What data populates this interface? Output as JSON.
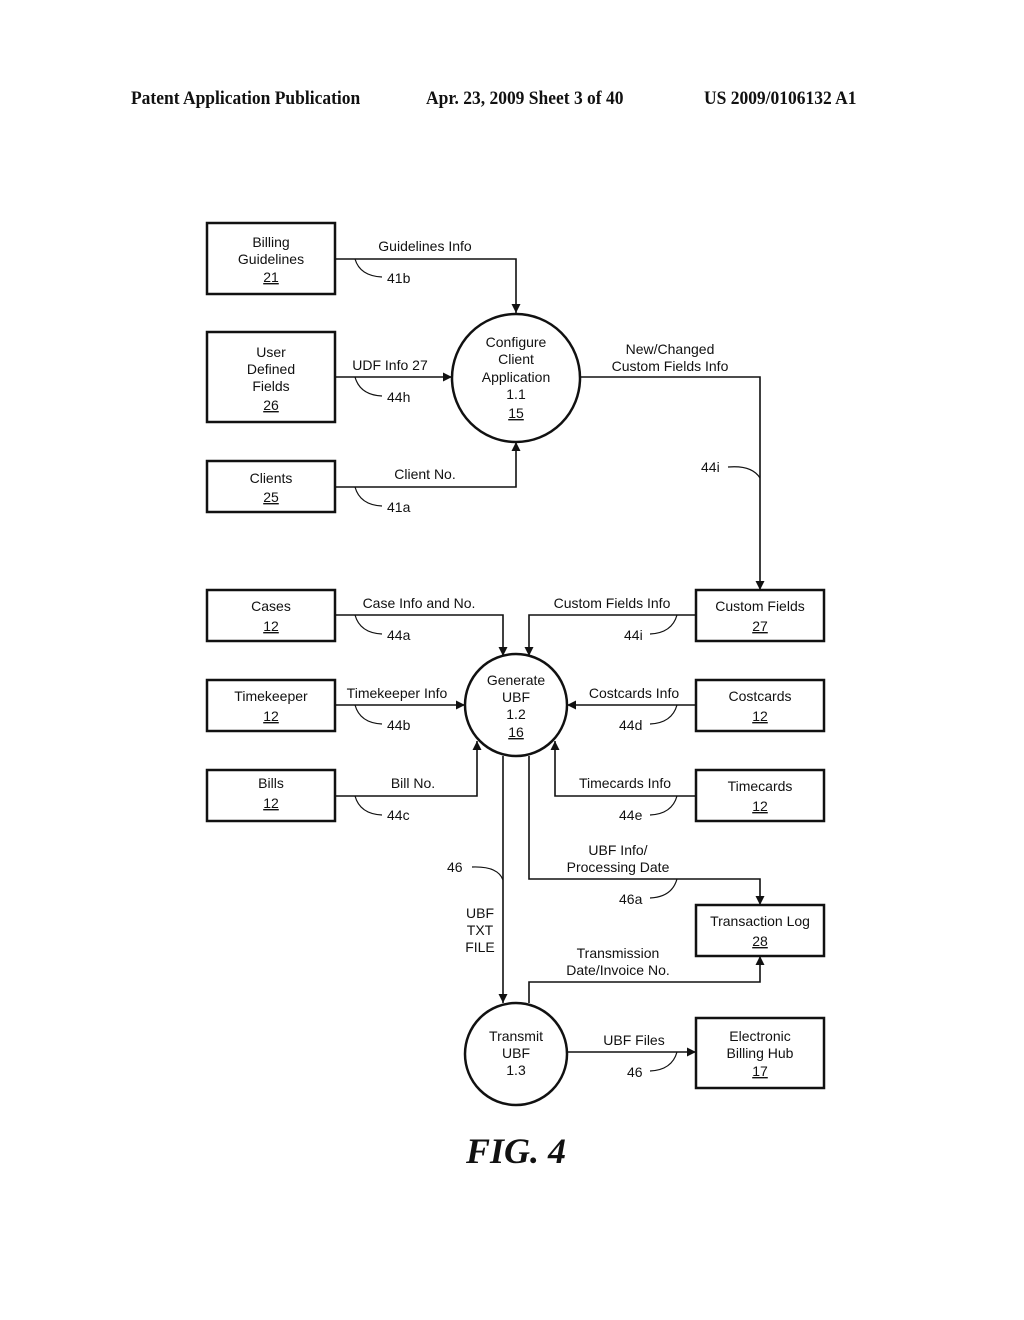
{
  "header": {
    "left": "Patent Application Publication",
    "center": "Apr. 23, 2009  Sheet 3 of 40",
    "right": "US 2009/0106132 A1"
  },
  "figure_label": "FIG. 4",
  "stores": {
    "billing_guidelines": {
      "lines": [
        "Billing",
        "Guidelines"
      ],
      "ref": "21"
    },
    "user_defined_fields": {
      "lines": [
        "User",
        "Defined",
        "Fields"
      ],
      "ref": "26"
    },
    "clients": {
      "lines": [
        "Clients"
      ],
      "ref": "25"
    },
    "custom_fields": {
      "lines": [
        "Custom Fields"
      ],
      "ref": "27"
    },
    "cases": {
      "lines": [
        "Cases"
      ],
      "ref": "12"
    },
    "timekeeper": {
      "lines": [
        "Timekeeper"
      ],
      "ref": "12"
    },
    "bills": {
      "lines": [
        "Bills"
      ],
      "ref": "12"
    },
    "costcards": {
      "lines": [
        "Costcards"
      ],
      "ref": "12"
    },
    "timecards": {
      "lines": [
        "Timecards"
      ],
      "ref": "12"
    },
    "transaction_log": {
      "lines": [
        "Transaction Log"
      ],
      "ref": "28"
    },
    "billing_hub": {
      "lines": [
        "Electronic",
        "Billing Hub"
      ],
      "ref": "17"
    }
  },
  "processes": {
    "configure": {
      "lines": [
        "Configure",
        "Client",
        "Application",
        "1.1"
      ],
      "ref": "15"
    },
    "generate": {
      "lines": [
        "Generate",
        "UBF",
        "1.2"
      ],
      "ref": "16"
    },
    "transmit": {
      "lines": [
        "Transmit",
        "UBF",
        "1.3"
      ]
    }
  },
  "flows": {
    "guidelines_info": {
      "label": "Guidelines Info",
      "ref": "41b"
    },
    "udf_info": {
      "label": "UDF Info 27",
      "ref": "44h"
    },
    "client_no": {
      "label": "Client No.",
      "ref": "41a"
    },
    "new_changed": {
      "label": [
        "New/Changed",
        "Custom Fields Info"
      ],
      "ref": "44i"
    },
    "case_info": {
      "label": "Case Info and No.",
      "ref": "44a"
    },
    "custom_fields_info": {
      "label": "Custom Fields Info",
      "ref": "44i"
    },
    "timekeeper_info": {
      "label": "Timekeeper Info",
      "ref": "44b"
    },
    "costcards_info": {
      "label": "Costcards Info",
      "ref": "44d"
    },
    "bill_no": {
      "label": "Bill No.",
      "ref": "44c"
    },
    "timecards_info": {
      "label": "Timecards Info",
      "ref": "44e"
    },
    "ubf_txt": {
      "label": [
        "UBF",
        "TXT",
        "FILE"
      ],
      "ref": "46"
    },
    "ubf_info": {
      "label": [
        "UBF Info/",
        "Processing Date"
      ],
      "ref": "46a"
    },
    "transmission": {
      "label": [
        "Transmission",
        "Date/Invoice No."
      ]
    },
    "ubf_files": {
      "label": "UBF Files",
      "ref": "46"
    }
  }
}
